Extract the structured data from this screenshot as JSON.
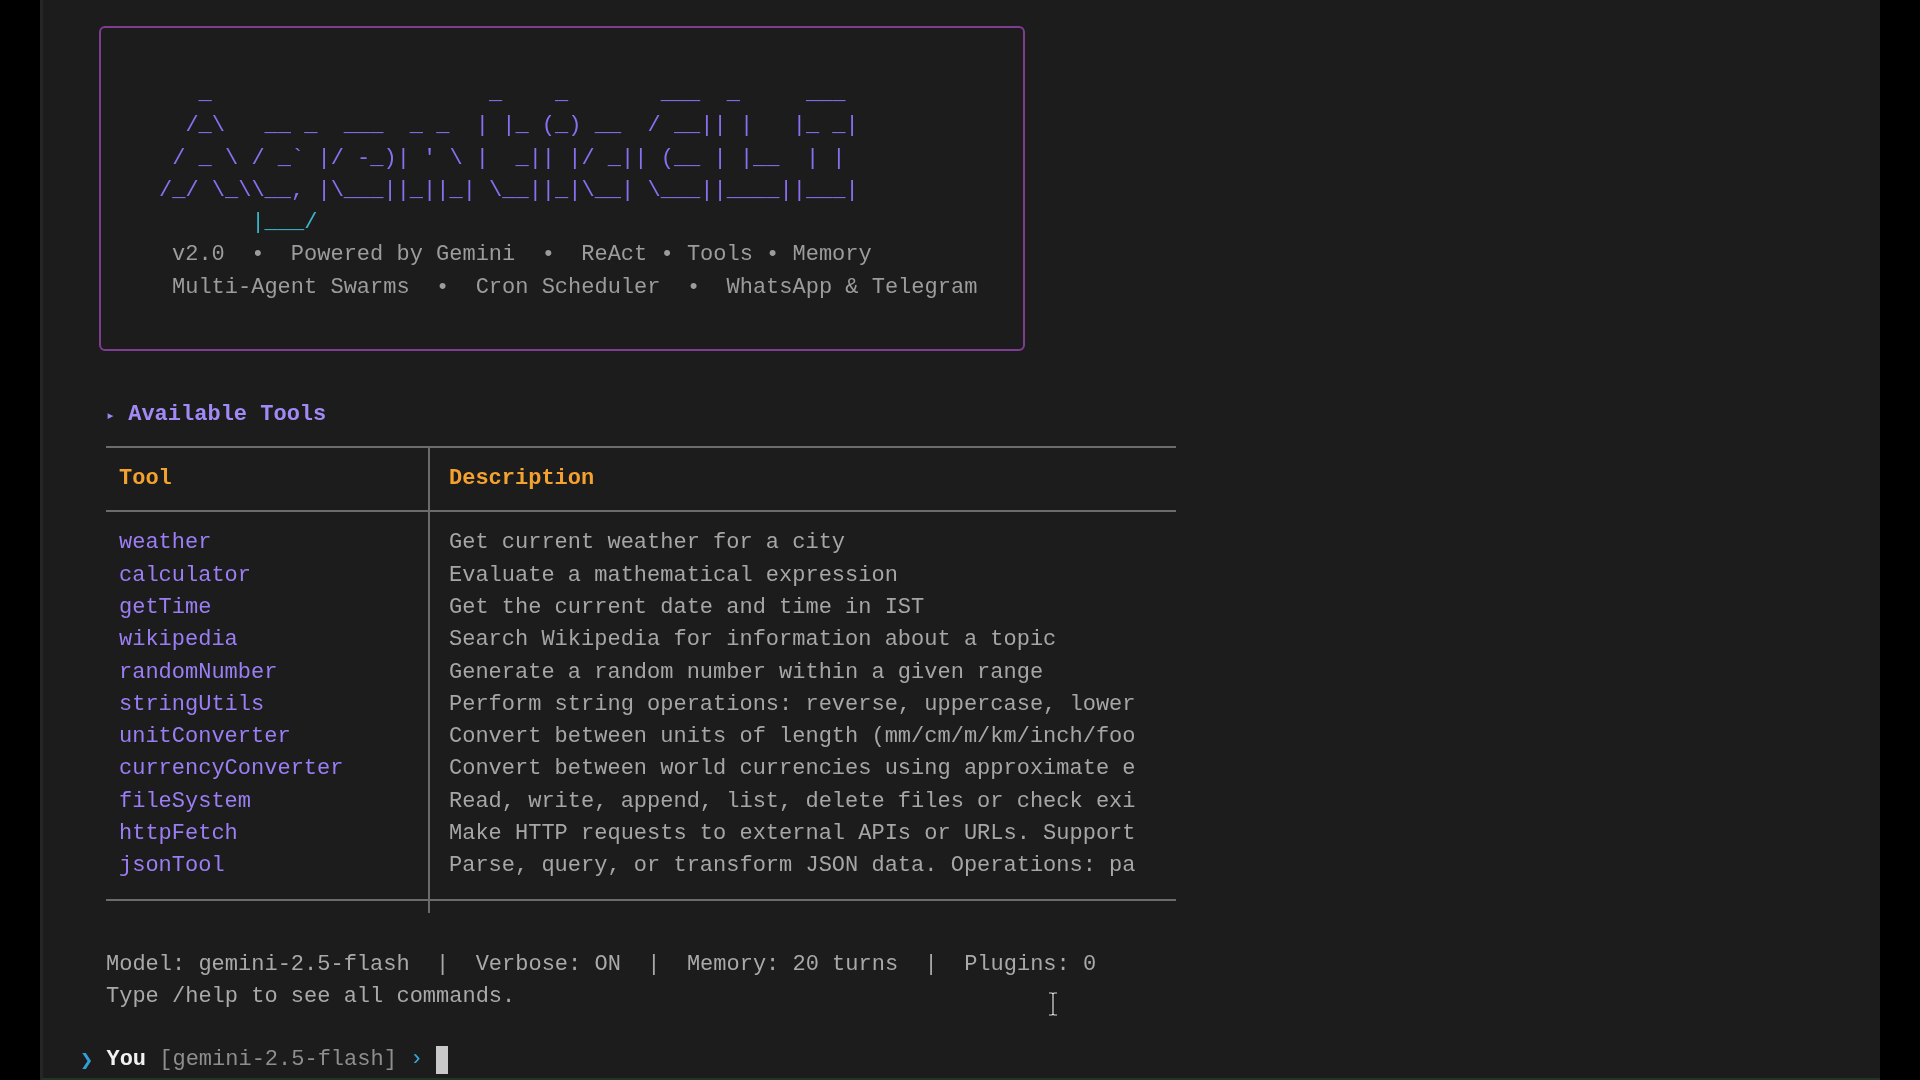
{
  "banner": {
    "art": [
      {
        "text": "   _                     _    _       ___  _     ___",
        "color": "#8a6ff0"
      },
      {
        "text": "  /_\\   __ _  ___  _ _  | |_ (_) __  / __|| |   |_ _|",
        "color": "#8a6ff0"
      },
      {
        "text": " / _ \\ / _` |/ -_)| ' \\ |  _|| |/ _|| (__ | |__  | |",
        "color": "#8a6ff0"
      },
      {
        "text": "/_/ \\_\\\\__, |\\___||_||_| \\__||_|\\__| \\___||____||___|",
        "color": "#8a6ff0"
      },
      {
        "text": "       |___/",
        "color": "#3bb5c9"
      }
    ],
    "taglines": [
      "v2.0  •  Powered by Gemini  •  ReAct • Tools • Memory",
      "Multi-Agent Swarms  •  Cron Scheduler  •  WhatsApp & Telegram"
    ]
  },
  "tools_section": {
    "marker": "▸",
    "title": "Available Tools",
    "table": {
      "columns": [
        "Tool",
        "Description"
      ],
      "rows": [
        {
          "tool": "weather",
          "description": "Get current weather for a city"
        },
        {
          "tool": "calculator",
          "description": "Evaluate a mathematical expression"
        },
        {
          "tool": "getTime",
          "description": "Get the current date and time in IST"
        },
        {
          "tool": "wikipedia",
          "description": "Search Wikipedia for information about a topic"
        },
        {
          "tool": "randomNumber",
          "description": "Generate a random number within a given range"
        },
        {
          "tool": "stringUtils",
          "description": "Perform string operations: reverse, uppercase, lower"
        },
        {
          "tool": "unitConverter",
          "description": "Convert between units of length (mm/cm/m/km/inch/foo"
        },
        {
          "tool": "currencyConverter",
          "description": "Convert between world currencies using approximate e"
        },
        {
          "tool": "fileSystem",
          "description": "Read, write, append, list, delete files or check exi"
        },
        {
          "tool": "httpFetch",
          "description": "Make HTTP requests to external APIs or URLs. Support"
        },
        {
          "tool": "jsonTool",
          "description": "Parse, query, or transform JSON data. Operations: pa"
        }
      ]
    }
  },
  "status": {
    "lines": [
      "Model: gemini-2.5-flash  |  Verbose: ON  |  Memory: 20 turns  |  Plugins: 0",
      "Type /help to see all commands."
    ]
  },
  "prompt": {
    "symbol": "❯",
    "user": "You",
    "model": "[gemini-2.5-flash]",
    "arrow": "›"
  }
}
